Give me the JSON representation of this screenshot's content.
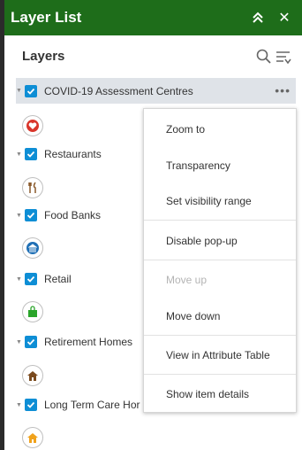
{
  "panel": {
    "title": "Layer List"
  },
  "layers_header": {
    "label": "Layers"
  },
  "layers": [
    {
      "name": "COVID-19 Assessment Centres",
      "symbol_color": "#d9362b",
      "symbol": "heart-monitor-icon"
    },
    {
      "name": "Restaurants",
      "symbol_color": "#8a5a2b",
      "symbol": "fork-knife-icon"
    },
    {
      "name": "Food Banks",
      "symbol_color": "#1f6fb5",
      "symbol": "bank-icon"
    },
    {
      "name": "Retail",
      "symbol_color": "#2aa52a",
      "symbol": "shopping-bag-icon"
    },
    {
      "name": "Retirement Homes",
      "symbol_color": "#7a4a1e",
      "symbol": "house-icon"
    },
    {
      "name": "Long Term Care Hor",
      "symbol_color": "#f0a21c",
      "symbol": "house-icon"
    }
  ],
  "context_menu": {
    "items": [
      {
        "label": "Zoom to",
        "enabled": true
      },
      {
        "label": "Transparency",
        "enabled": true
      },
      {
        "label": "Set visibility range",
        "enabled": true
      },
      {
        "label": "Disable pop-up",
        "enabled": true
      },
      {
        "label": "Move up",
        "enabled": false
      },
      {
        "label": "Move down",
        "enabled": true
      },
      {
        "label": "View in Attribute Table",
        "enabled": true
      },
      {
        "label": "Show item details",
        "enabled": true
      }
    ]
  },
  "colors": {
    "titlebar": "#1e6d1a",
    "checkbox": "#0e8ed5",
    "selected_row": "#dfe3e8"
  }
}
